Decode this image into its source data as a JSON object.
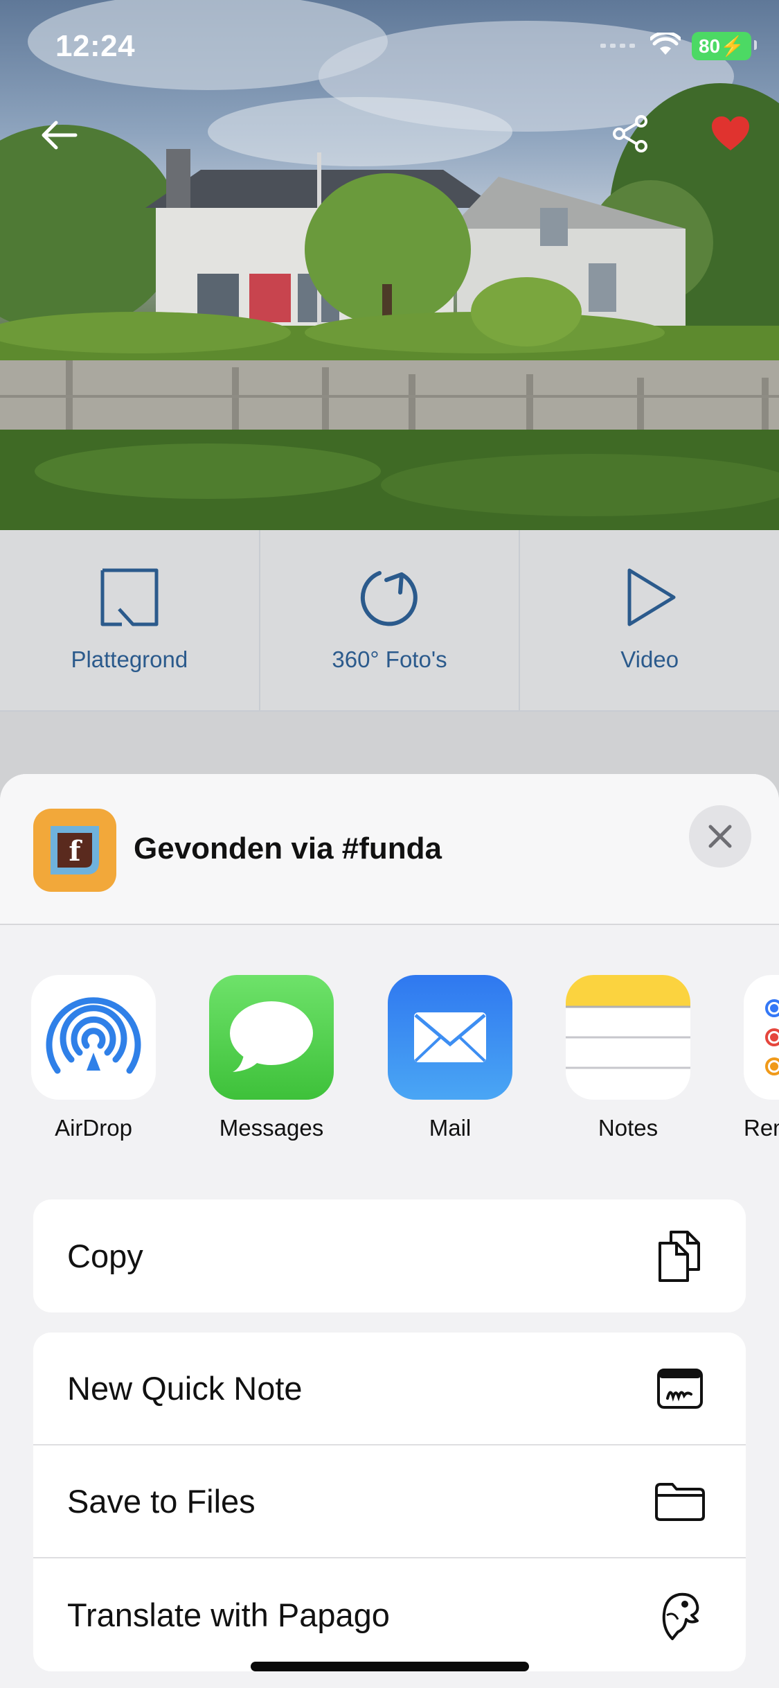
{
  "status_bar": {
    "time": "12:24",
    "battery": "80"
  },
  "media_tabs": [
    {
      "label": "Plattegrond",
      "icon": "floorplan-icon"
    },
    {
      "label": "360° Foto's",
      "icon": "rotate-360-icon"
    },
    {
      "label": "Video",
      "icon": "play-icon"
    }
  ],
  "share_sheet": {
    "title": "Gevonden via #funda",
    "app_icon_letter": "f",
    "apps": [
      {
        "label": "AirDrop",
        "icon": "airdrop-icon"
      },
      {
        "label": "Messages",
        "icon": "messages-icon"
      },
      {
        "label": "Mail",
        "icon": "mail-icon"
      },
      {
        "label": "Notes",
        "icon": "notes-icon"
      },
      {
        "label": "Rem",
        "icon": "reminders-icon"
      }
    ],
    "actions_group1": [
      {
        "label": "Copy",
        "icon": "copy-icon"
      }
    ],
    "actions_group2": [
      {
        "label": "New Quick Note",
        "icon": "quick-note-icon"
      },
      {
        "label": "Save to Files",
        "icon": "folder-icon"
      },
      {
        "label": "Translate with Papago",
        "icon": "papago-icon"
      }
    ]
  },
  "colors": {
    "accent_blue": "#2b5a8c",
    "favorite_red": "#e0332f",
    "funda_orange": "#f2a83a"
  }
}
